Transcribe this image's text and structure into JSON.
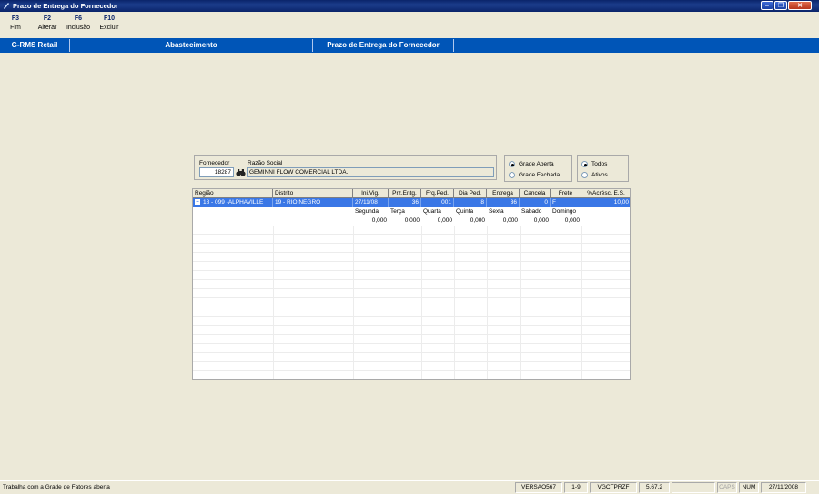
{
  "window": {
    "title": "Prazo de Entrega do Fornecedor"
  },
  "fkeys": [
    {
      "key": "F3",
      "label": "Fim"
    },
    {
      "key": "F2",
      "label": "Alterar"
    },
    {
      "key": "F6",
      "label": "Inclusão"
    },
    {
      "key": "F10",
      "label": "Excluir"
    }
  ],
  "nav": {
    "app": "G-RMS Retail",
    "module": "Abastecimento",
    "screen": "Prazo de Entrega do Fornecedor"
  },
  "supplier": {
    "code_label": "Fornecedor",
    "code": "18287",
    "name_label": "Razão Social",
    "name": "GEMINNI FLOW COMERCIAL LTDA."
  },
  "grade_options": {
    "selected": "Grade Aberta",
    "options": [
      "Grade Aberta",
      "Grade Fechada"
    ]
  },
  "filter_options": {
    "selected": "Todos",
    "options": [
      "Todos",
      "Ativos"
    ]
  },
  "grid": {
    "columns": [
      "Região",
      "Distrito",
      "Ini.Vig.",
      "Prz.Entg.",
      "Frq.Ped.",
      "Dia Ped.",
      "Entrega",
      "Cancela",
      "Frete",
      "%Acrésc. E.S."
    ],
    "row": {
      "regiao": "18 - 099 -ALPHAVILLE",
      "distrito": "19 - RIO NEGRO",
      "ini_vig": "27/11/08",
      "prz_entg": "36",
      "frq_ped": "001",
      "dia_ped": "8",
      "entrega": "36",
      "cancela": "0",
      "frete": "F",
      "acresc": "10,00"
    },
    "days_header": [
      "Segunda",
      "Terça",
      "Quarta",
      "Quinta",
      "Sexta",
      "Sabado",
      "Domingo"
    ],
    "days_values": [
      "0,000",
      "0,000",
      "0,000",
      "0,000",
      "0,000",
      "0,000",
      "0,000"
    ]
  },
  "status": {
    "message": "Trabalha com a Grade de Fatores aberta",
    "panels": [
      "VERSAO567",
      "1-9",
      "VGCTPRZF",
      "5.67.2",
      "",
      "CAPS",
      "NUM",
      "27/11/2008"
    ]
  },
  "colors": {
    "nav_blue": "#0055b7",
    "selection_blue": "#3a77e6",
    "title_blue": "#0a246a"
  }
}
